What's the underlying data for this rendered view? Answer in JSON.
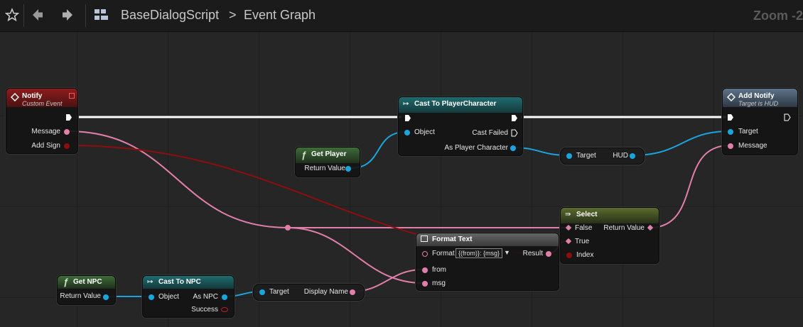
{
  "toolbar": {
    "breadcrumb_blueprint": "BaseDialogScript",
    "breadcrumb_separator": ">",
    "breadcrumb_graph": "Event Graph",
    "zoom_label": "Zoom -2",
    "icons": [
      "star-icon",
      "back-arrow-icon",
      "forward-arrow-icon",
      "blueprint-graph-icon"
    ]
  },
  "colors": {
    "exec": "#ffffff",
    "object_pin": "#19a6e0",
    "string_pin": "#e07faa",
    "text_pin": "#e07faa",
    "bool_pin": "#8c0e0e",
    "event_header": "#8c1c1c",
    "cast_header": "#1f6b6e",
    "function_header": "#5d7389"
  },
  "nodes": {
    "notify": {
      "title": "Notify",
      "subtitle": "Custom Event",
      "pins": {
        "message": "Message",
        "add_sign": "Add Sign"
      }
    },
    "get_player": {
      "title": "Get Player",
      "pins": {
        "return_value": "Return Value"
      }
    },
    "cast_player": {
      "title": "Cast To PlayerCharacter",
      "pins": {
        "object": "Object",
        "cast_failed": "Cast Failed",
        "as_player": "As Player Character"
      }
    },
    "hud_get": {
      "pins": {
        "target": "Target",
        "hud": "HUD"
      }
    },
    "add_notify": {
      "title": "Add Notify",
      "subtitle": "Target is HUD",
      "pins": {
        "target": "Target",
        "message": "Message"
      }
    },
    "select": {
      "title": "Select",
      "pins": {
        "false": "False",
        "true": "True",
        "index": "Index",
        "return_value": "Return Value"
      }
    },
    "format_text": {
      "title": "Format Text",
      "pins": {
        "format": "Format",
        "format_value": "{(from)}: {msg}",
        "result": "Result",
        "from": "from",
        "msg": "msg"
      }
    },
    "get_npc": {
      "title": "Get NPC",
      "pins": {
        "return_value": "Return Value"
      }
    },
    "cast_npc": {
      "title": "Cast To NPC",
      "pins": {
        "object": "Object",
        "as_npc": "As NPC",
        "success": "Success"
      }
    },
    "display_name": {
      "pins": {
        "target": "Target",
        "display_name": "Display Name"
      }
    }
  }
}
